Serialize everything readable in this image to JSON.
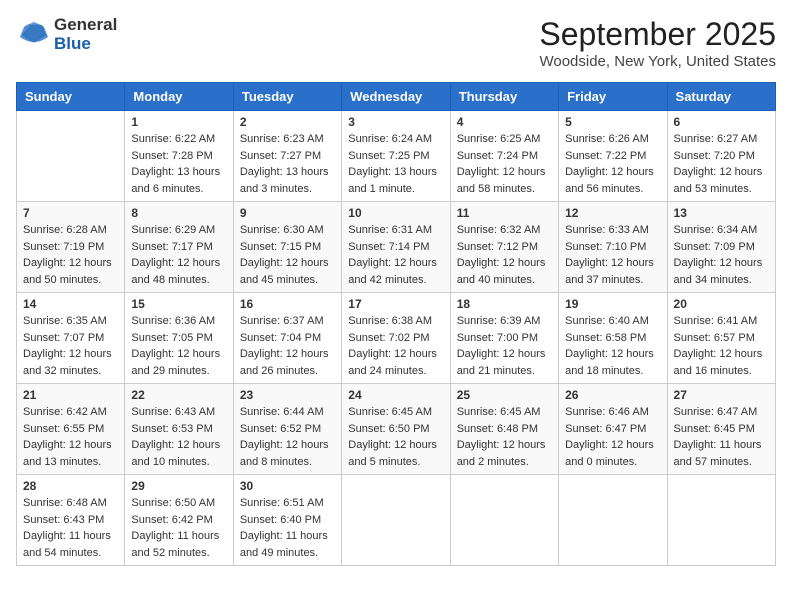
{
  "header": {
    "title": "September 2025",
    "subtitle": "Woodside, New York, United States",
    "logo_general": "General",
    "logo_blue": "Blue"
  },
  "calendar": {
    "days_of_week": [
      "Sunday",
      "Monday",
      "Tuesday",
      "Wednesday",
      "Thursday",
      "Friday",
      "Saturday"
    ],
    "weeks": [
      [
        {
          "day": "",
          "sunrise": "",
          "sunset": "",
          "daylight": ""
        },
        {
          "day": "1",
          "sunrise": "Sunrise: 6:22 AM",
          "sunset": "Sunset: 7:28 PM",
          "daylight": "Daylight: 13 hours and 6 minutes."
        },
        {
          "day": "2",
          "sunrise": "Sunrise: 6:23 AM",
          "sunset": "Sunset: 7:27 PM",
          "daylight": "Daylight: 13 hours and 3 minutes."
        },
        {
          "day": "3",
          "sunrise": "Sunrise: 6:24 AM",
          "sunset": "Sunset: 7:25 PM",
          "daylight": "Daylight: 13 hours and 1 minute."
        },
        {
          "day": "4",
          "sunrise": "Sunrise: 6:25 AM",
          "sunset": "Sunset: 7:24 PM",
          "daylight": "Daylight: 12 hours and 58 minutes."
        },
        {
          "day": "5",
          "sunrise": "Sunrise: 6:26 AM",
          "sunset": "Sunset: 7:22 PM",
          "daylight": "Daylight: 12 hours and 56 minutes."
        },
        {
          "day": "6",
          "sunrise": "Sunrise: 6:27 AM",
          "sunset": "Sunset: 7:20 PM",
          "daylight": "Daylight: 12 hours and 53 minutes."
        }
      ],
      [
        {
          "day": "7",
          "sunrise": "Sunrise: 6:28 AM",
          "sunset": "Sunset: 7:19 PM",
          "daylight": "Daylight: 12 hours and 50 minutes."
        },
        {
          "day": "8",
          "sunrise": "Sunrise: 6:29 AM",
          "sunset": "Sunset: 7:17 PM",
          "daylight": "Daylight: 12 hours and 48 minutes."
        },
        {
          "day": "9",
          "sunrise": "Sunrise: 6:30 AM",
          "sunset": "Sunset: 7:15 PM",
          "daylight": "Daylight: 12 hours and 45 minutes."
        },
        {
          "day": "10",
          "sunrise": "Sunrise: 6:31 AM",
          "sunset": "Sunset: 7:14 PM",
          "daylight": "Daylight: 12 hours and 42 minutes."
        },
        {
          "day": "11",
          "sunrise": "Sunrise: 6:32 AM",
          "sunset": "Sunset: 7:12 PM",
          "daylight": "Daylight: 12 hours and 40 minutes."
        },
        {
          "day": "12",
          "sunrise": "Sunrise: 6:33 AM",
          "sunset": "Sunset: 7:10 PM",
          "daylight": "Daylight: 12 hours and 37 minutes."
        },
        {
          "day": "13",
          "sunrise": "Sunrise: 6:34 AM",
          "sunset": "Sunset: 7:09 PM",
          "daylight": "Daylight: 12 hours and 34 minutes."
        }
      ],
      [
        {
          "day": "14",
          "sunrise": "Sunrise: 6:35 AM",
          "sunset": "Sunset: 7:07 PM",
          "daylight": "Daylight: 12 hours and 32 minutes."
        },
        {
          "day": "15",
          "sunrise": "Sunrise: 6:36 AM",
          "sunset": "Sunset: 7:05 PM",
          "daylight": "Daylight: 12 hours and 29 minutes."
        },
        {
          "day": "16",
          "sunrise": "Sunrise: 6:37 AM",
          "sunset": "Sunset: 7:04 PM",
          "daylight": "Daylight: 12 hours and 26 minutes."
        },
        {
          "day": "17",
          "sunrise": "Sunrise: 6:38 AM",
          "sunset": "Sunset: 7:02 PM",
          "daylight": "Daylight: 12 hours and 24 minutes."
        },
        {
          "day": "18",
          "sunrise": "Sunrise: 6:39 AM",
          "sunset": "Sunset: 7:00 PM",
          "daylight": "Daylight: 12 hours and 21 minutes."
        },
        {
          "day": "19",
          "sunrise": "Sunrise: 6:40 AM",
          "sunset": "Sunset: 6:58 PM",
          "daylight": "Daylight: 12 hours and 18 minutes."
        },
        {
          "day": "20",
          "sunrise": "Sunrise: 6:41 AM",
          "sunset": "Sunset: 6:57 PM",
          "daylight": "Daylight: 12 hours and 16 minutes."
        }
      ],
      [
        {
          "day": "21",
          "sunrise": "Sunrise: 6:42 AM",
          "sunset": "Sunset: 6:55 PM",
          "daylight": "Daylight: 12 hours and 13 minutes."
        },
        {
          "day": "22",
          "sunrise": "Sunrise: 6:43 AM",
          "sunset": "Sunset: 6:53 PM",
          "daylight": "Daylight: 12 hours and 10 minutes."
        },
        {
          "day": "23",
          "sunrise": "Sunrise: 6:44 AM",
          "sunset": "Sunset: 6:52 PM",
          "daylight": "Daylight: 12 hours and 8 minutes."
        },
        {
          "day": "24",
          "sunrise": "Sunrise: 6:45 AM",
          "sunset": "Sunset: 6:50 PM",
          "daylight": "Daylight: 12 hours and 5 minutes."
        },
        {
          "day": "25",
          "sunrise": "Sunrise: 6:45 AM",
          "sunset": "Sunset: 6:48 PM",
          "daylight": "Daylight: 12 hours and 2 minutes."
        },
        {
          "day": "26",
          "sunrise": "Sunrise: 6:46 AM",
          "sunset": "Sunset: 6:47 PM",
          "daylight": "Daylight: 12 hours and 0 minutes."
        },
        {
          "day": "27",
          "sunrise": "Sunrise: 6:47 AM",
          "sunset": "Sunset: 6:45 PM",
          "daylight": "Daylight: 11 hours and 57 minutes."
        }
      ],
      [
        {
          "day": "28",
          "sunrise": "Sunrise: 6:48 AM",
          "sunset": "Sunset: 6:43 PM",
          "daylight": "Daylight: 11 hours and 54 minutes."
        },
        {
          "day": "29",
          "sunrise": "Sunrise: 6:50 AM",
          "sunset": "Sunset: 6:42 PM",
          "daylight": "Daylight: 11 hours and 52 minutes."
        },
        {
          "day": "30",
          "sunrise": "Sunrise: 6:51 AM",
          "sunset": "Sunset: 6:40 PM",
          "daylight": "Daylight: 11 hours and 49 minutes."
        },
        {
          "day": "",
          "sunrise": "",
          "sunset": "",
          "daylight": ""
        },
        {
          "day": "",
          "sunrise": "",
          "sunset": "",
          "daylight": ""
        },
        {
          "day": "",
          "sunrise": "",
          "sunset": "",
          "daylight": ""
        },
        {
          "day": "",
          "sunrise": "",
          "sunset": "",
          "daylight": ""
        }
      ]
    ]
  }
}
